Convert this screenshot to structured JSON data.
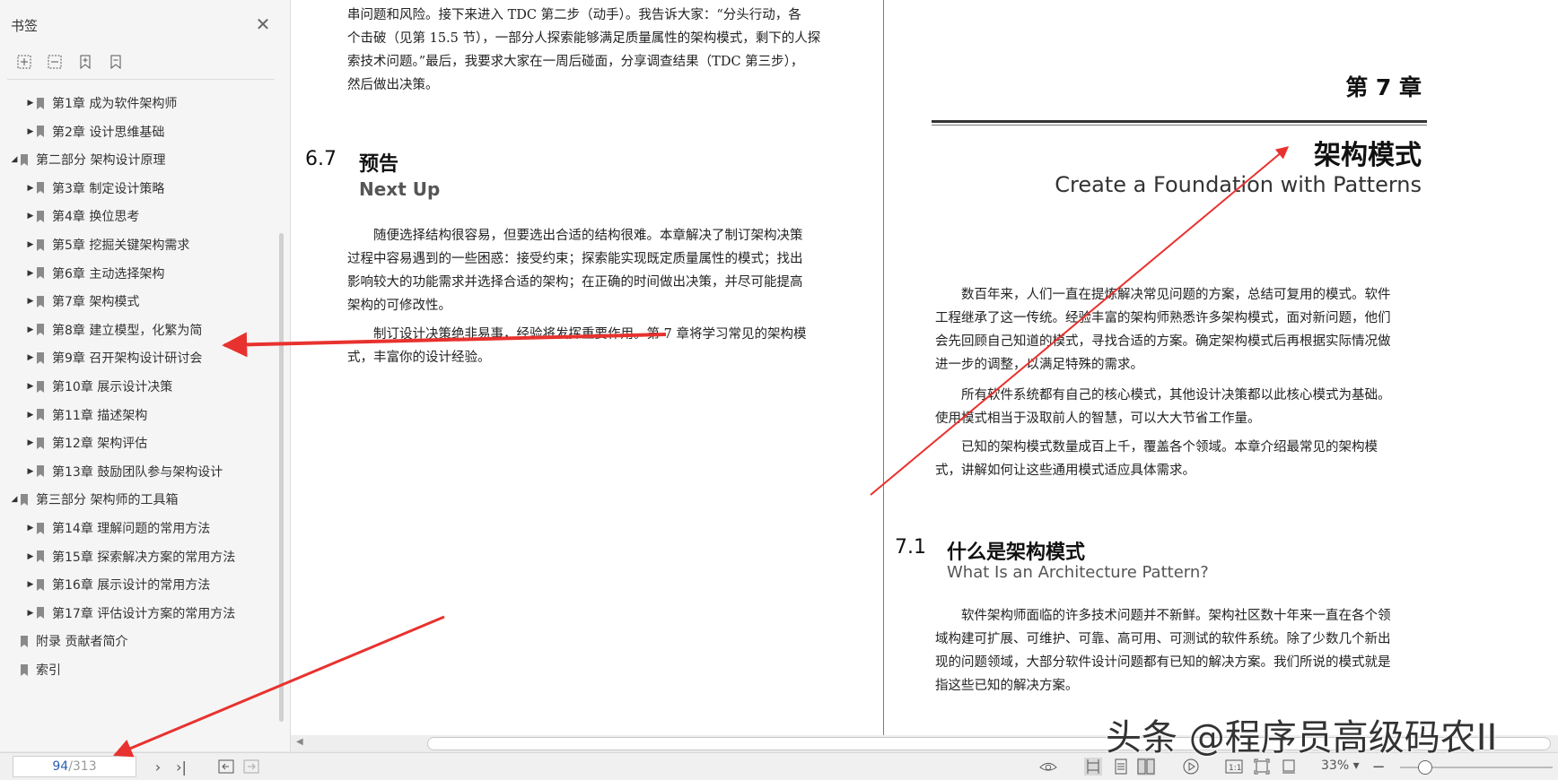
{
  "sidebar": {
    "title": "书签",
    "items": [
      {
        "label": "第1章  成为软件架构师",
        "level": 2,
        "expander": "collapsed"
      },
      {
        "label": "第2章  设计思维基础",
        "level": 2,
        "expander": "collapsed"
      },
      {
        "label": "第二部分  架构设计原理",
        "level": 1,
        "expander": "expanded"
      },
      {
        "label": "第3章  制定设计策略",
        "level": 2,
        "expander": "collapsed"
      },
      {
        "label": "第4章  换位思考",
        "level": 2,
        "expander": "collapsed"
      },
      {
        "label": "第5章  挖掘关键架构需求",
        "level": 2,
        "expander": "collapsed"
      },
      {
        "label": "第6章  主动选择架构",
        "level": 2,
        "expander": "collapsed"
      },
      {
        "label": "第7章  架构模式",
        "level": 2,
        "expander": "collapsed",
        "selected": true
      },
      {
        "label": "第8章  建立模型，化繁为简",
        "level": 2,
        "expander": "collapsed"
      },
      {
        "label": "第9章  召开架构设计研讨会",
        "level": 2,
        "expander": "collapsed"
      },
      {
        "label": "第10章  展示设计决策",
        "level": 2,
        "expander": "collapsed"
      },
      {
        "label": "第11章  描述架构",
        "level": 2,
        "expander": "collapsed"
      },
      {
        "label": "第12章  架构评估",
        "level": 2,
        "expander": "collapsed"
      },
      {
        "label": "第13章  鼓励团队参与架构设计",
        "level": 2,
        "expander": "collapsed"
      },
      {
        "label": "第三部分  架构师的工具箱",
        "level": 1,
        "expander": "expanded"
      },
      {
        "label": "第14章  理解问题的常用方法",
        "level": 2,
        "expander": "collapsed"
      },
      {
        "label": "第15章  探索解决方案的常用方法",
        "level": 2,
        "expander": "collapsed"
      },
      {
        "label": "第16章  展示设计的常用方法",
        "level": 2,
        "expander": "collapsed"
      },
      {
        "label": "第17章  评估设计方案的常用方法",
        "level": 2,
        "expander": "collapsed"
      },
      {
        "label": "附录  贡献者简介",
        "level": 1,
        "expander": "none"
      },
      {
        "label": "索引",
        "level": 1,
        "expander": "none"
      }
    ]
  },
  "left_page": {
    "para_top": [
      "串问题和风险。接下来进入 TDC 第二步（动手）。我告诉大家：“分头行动，各",
      "个击破（见第 15.5 节），一部分人探索能够满足质量属性的架构模式，剩下的人探",
      "索技术问题。”最后，我要求大家在一周后碰面，分享调查结果（TDC 第三步），",
      "然后做出决策。"
    ],
    "section_num": "6.7",
    "section_cn": "预告",
    "section_en": "Next Up",
    "para1": [
      "随便选择结构很容易，但要选出合适的结构很难。本章解决了制订架构决策",
      "过程中容易遇到的一些困惑：接受约束；探索能实现既定质量属性的模式；找出",
      "影响较大的功能需求并选择合适的架构；在正确的时间做出决策，并尽可能提高",
      "架构的可修改性。"
    ],
    "para2": [
      "制订设计决策绝非易事，经验将发挥重要作用。第 7 章将学习常见的架构模",
      "式，丰富你的设计经验。"
    ]
  },
  "right_page": {
    "chapter": "第 7 章",
    "title_cn": "架构模式",
    "title_en": "Create a Foundation with Patterns",
    "para1": [
      "数百年来，人们一直在提炼解决常见问题的方案，总结可复用的模式。软件",
      "工程继承了这一传统。经验丰富的架构师熟悉许多架构模式，面对新问题，他们",
      "会先回顾自己知道的模式，寻找合适的方案。确定架构模式后再根据实际情况做",
      "进一步的调整，以满足特殊的需求。"
    ],
    "para2": [
      "所有软件系统都有自己的核心模式，其他设计决策都以此核心模式为基础。",
      "使用模式相当于汲取前人的智慧，可以大大节省工作量。"
    ],
    "para3": [
      "已知的架构模式数量成百上千，覆盖各个领域。本章介绍最常见的架构模",
      "式，讲解如何让这些通用模式适应具体需求。"
    ],
    "section_num": "7.1",
    "section_cn": "什么是架构模式",
    "section_en": "What Is an Architecture Pattern?",
    "para4": [
      "软件架构师面临的许多技术问题并不新鲜。架构社区数十年来一直在各个领",
      "域构建可扩展、可维护、可靠、高可用、可测试的软件系统。除了少数几个新出",
      "现的问题领域，大部分软件设计问题都有已知的解决方案。我们所说的模式就是",
      "指这些已知的解决方案。"
    ]
  },
  "statusbar": {
    "page_current": "94",
    "page_total": "/313",
    "zoom": "33%"
  },
  "watermark": "头条 @程序员高级码农II",
  "colors": {
    "annotation": "#e8322f",
    "selected_row": "#dedede"
  }
}
